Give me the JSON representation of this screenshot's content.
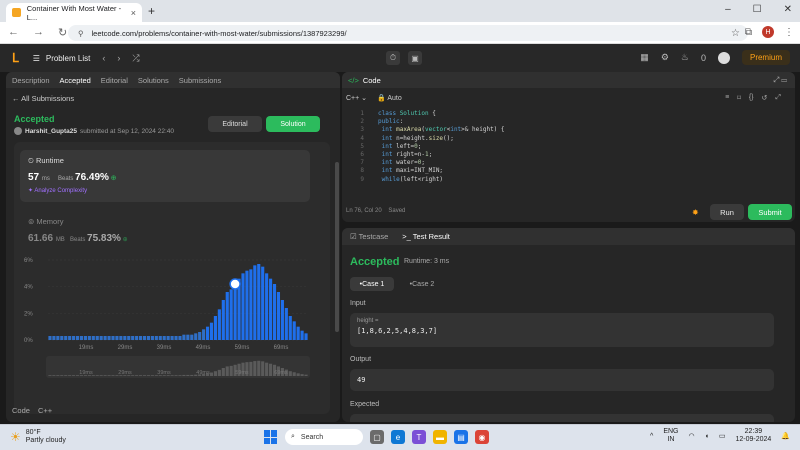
{
  "browser": {
    "tab_title": "Container With Most Water - L...",
    "url": "leetcode.com/problems/container-with-most-water/submissions/1387923299/",
    "profile_initial": "H"
  },
  "header": {
    "problem_list_label": "Problem List",
    "streak_count": "0",
    "premium_label": "Premium"
  },
  "left_panel": {
    "tabs": [
      {
        "label": "Description"
      },
      {
        "label": "Accepted"
      },
      {
        "label": "Editorial"
      },
      {
        "label": "Solutions"
      },
      {
        "label": "Submissions"
      }
    ],
    "all_submissions_label": "All Submissions",
    "status": "Accepted",
    "username": "Harshit_Gupta25",
    "submitted_text": "submitted at Sep 12, 2024 22:40",
    "editorial_button": "Editorial",
    "solution_button": "Solution",
    "runtime": {
      "label": "Runtime",
      "value": "57",
      "unit": "ms",
      "beats_label": "Beats",
      "beats_value": "76.49%",
      "analyze_label": "Analyze Complexity"
    },
    "memory": {
      "label": "Memory",
      "value": "61.66",
      "unit": "MB",
      "beats_label": "Beats",
      "beats_value": "75.83%"
    },
    "footer_code_label": "Code",
    "footer_lang_label": "C++"
  },
  "chart_data": {
    "type": "bar",
    "ylim": [
      0,
      6
    ],
    "y_ticks": [
      "6%",
      "4%",
      "2%",
      "0%"
    ],
    "x_ticks": [
      "19ms",
      "29ms",
      "39ms",
      "49ms",
      "59ms",
      "69ms"
    ],
    "mini_x_ticks": [
      "19ms",
      "29ms",
      "39ms",
      "49ms",
      "59ms",
      "69ms"
    ],
    "values": [
      0.3,
      0.3,
      0.3,
      0.3,
      0.3,
      0.3,
      0.3,
      0.3,
      0.3,
      0.3,
      0.3,
      0.3,
      0.3,
      0.3,
      0.3,
      0.3,
      0.3,
      0.3,
      0.3,
      0.3,
      0.3,
      0.3,
      0.3,
      0.3,
      0.3,
      0.3,
      0.3,
      0.3,
      0.3,
      0.3,
      0.3,
      0.3,
      0.3,
      0.3,
      0.4,
      0.4,
      0.4,
      0.5,
      0.6,
      0.8,
      1.0,
      1.3,
      1.8,
      2.3,
      3.0,
      3.6,
      3.8,
      4.2,
      4.6,
      5.0,
      5.2,
      5.3,
      5.6,
      5.7,
      5.5,
      5.0,
      4.6,
      4.2,
      3.6,
      3.0,
      2.4,
      1.8,
      1.4,
      1.0,
      0.7,
      0.5
    ],
    "highlight_index": 47
  },
  "code_panel": {
    "title": "Code",
    "language": "C++",
    "mode": "Auto",
    "lines": [
      "class Solution {",
      "public:",
      "    int maxArea(vector<int>& height) {",
      "        int n=height.size();",
      "        int left=0;",
      "        int right=n-1;",
      "        int water=0;",
      "        int maxi=INT_MIN;",
      "        while(left<right)"
    ],
    "status_line": "Ln 76, Col 20",
    "saved_label": "Saved",
    "run_button": "Run",
    "submit_button": "Submit"
  },
  "test_panel": {
    "testcase_tab": "Testcase",
    "result_tab": "Test Result",
    "status": "Accepted",
    "runtime_text": "Runtime: 3 ms",
    "case1_label": "Case 1",
    "case2_label": "Case 2",
    "input_label": "Input",
    "input_var": "height =",
    "input_value": "[1,8,6,2,5,4,8,3,7]",
    "output_label": "Output",
    "output_value": "49",
    "expected_label": "Expected"
  },
  "taskbar": {
    "temperature": "80°F",
    "weather": "Partly cloudy",
    "search_label": "Search",
    "lang_top": "ENG",
    "lang_bottom": "IN",
    "time": "22:39",
    "date": "12-09-2024"
  }
}
